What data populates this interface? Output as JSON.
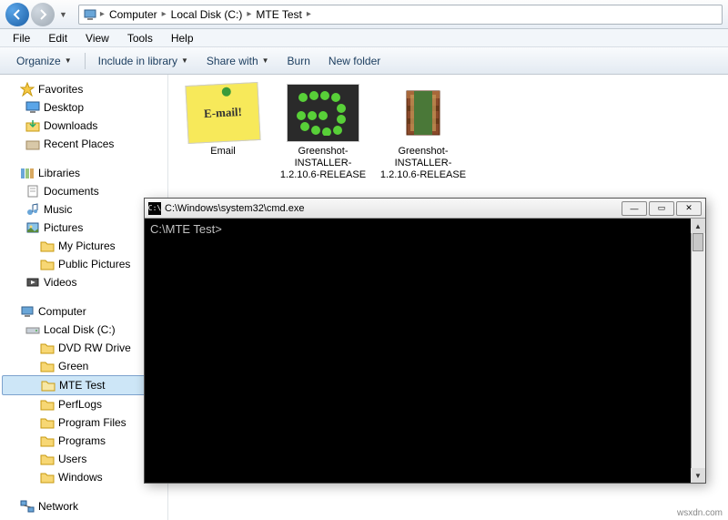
{
  "breadcrumb": {
    "items": [
      "Computer",
      "Local Disk (C:)",
      "MTE Test"
    ]
  },
  "menubar": [
    "File",
    "Edit",
    "View",
    "Tools",
    "Help"
  ],
  "toolbar": {
    "organize": "Organize",
    "include": "Include in library",
    "share": "Share with",
    "burn": "Burn",
    "newfolder": "New folder"
  },
  "nav": {
    "favorites": {
      "label": "Favorites",
      "items": [
        "Desktop",
        "Downloads",
        "Recent Places"
      ]
    },
    "libraries": {
      "label": "Libraries",
      "items": [
        "Documents",
        "Music",
        "Pictures",
        "Videos"
      ],
      "pictures_children": [
        "My Pictures",
        "Public Pictures"
      ]
    },
    "computer": {
      "label": "Computer",
      "disk": "Local Disk (C:)",
      "folders": [
        "DVD RW Drive",
        "Green",
        "MTE Test",
        "PerfLogs",
        "Program Files",
        "Programs",
        "Users",
        "Windows"
      ]
    },
    "network": {
      "label": "Network"
    }
  },
  "files": [
    {
      "name": "Email",
      "type": "note"
    },
    {
      "name": "Greenshot-INSTALLER-1.2.10.6-RELEASE",
      "type": "greenshot"
    },
    {
      "name": "Greenshot-INSTALLER-1.2.10.6-RELEASE",
      "type": "rar"
    }
  ],
  "cmd": {
    "title": "C:\\Windows\\system32\\cmd.exe",
    "prompt": "C:\\MTE Test>"
  },
  "watermark": "wsxdn.com"
}
